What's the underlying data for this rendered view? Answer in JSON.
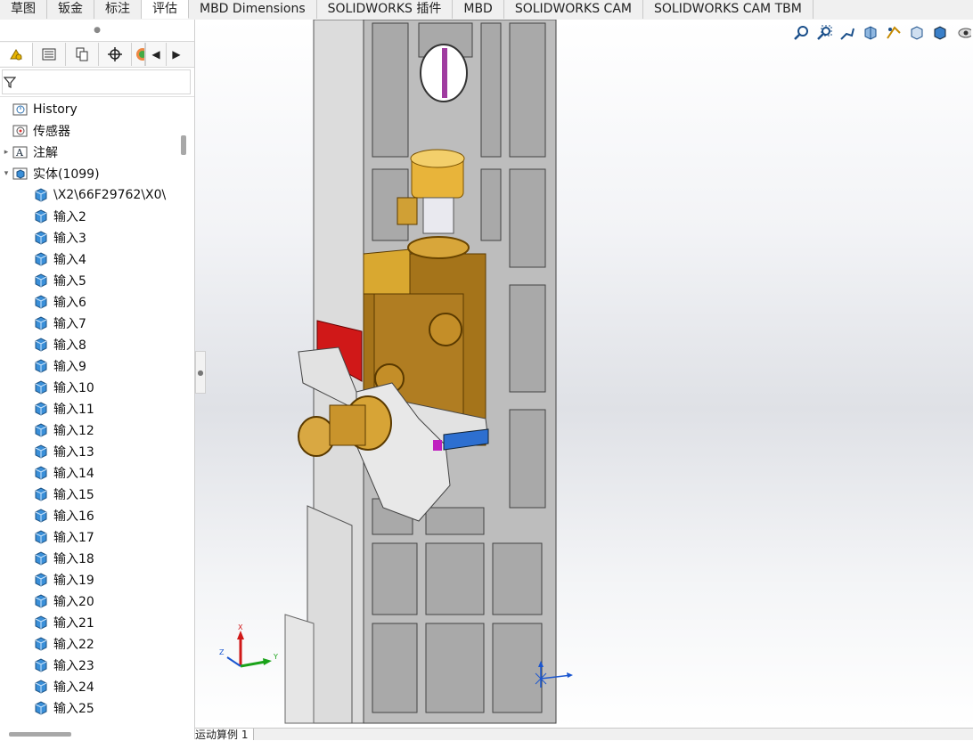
{
  "tabs": [
    "草图",
    "钣金",
    "标注",
    "评估",
    "MBD Dimensions",
    "SOLIDWORKS 插件",
    "MBD",
    "SOLIDWORKS CAM",
    "SOLIDWORKS CAM TBM"
  ],
  "active_tab": 3,
  "tree": {
    "history": "History",
    "sensors": "传感器",
    "annotations": "注解",
    "bodies": "实体(1099)",
    "items": [
      "\\X2\\66F29762\\X0\\",
      "输入2",
      "输入3",
      "输入4",
      "输入5",
      "输入6",
      "输入7",
      "输入8",
      "输入9",
      "输入10",
      "输入11",
      "输入12",
      "输入13",
      "输入14",
      "输入15",
      "输入16",
      "输入17",
      "输入18",
      "输入19",
      "输入20",
      "输入21",
      "输入22",
      "输入23",
      "输入24",
      "输入25"
    ]
  },
  "triad": {
    "x": "X",
    "y": "Y",
    "z": "Z"
  },
  "bottom": {
    "motion_tab": "运动算例 1"
  },
  "colors": {
    "accent": "#2e7dd6",
    "body_cube": "#3a8fd8",
    "gold": "#d4a020",
    "red": "#d01818",
    "machine_gray": "#c9c9c9"
  }
}
